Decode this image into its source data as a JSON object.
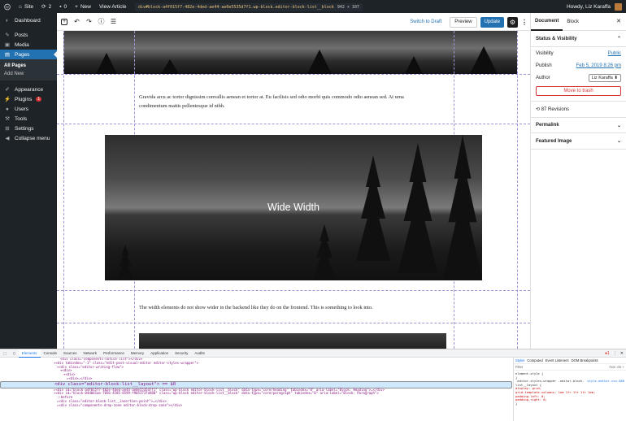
{
  "adminbar": {
    "site": "Site",
    "updates": "2",
    "comments": "0",
    "new": "New",
    "view": "View Article",
    "howdy": "Howdy, Liz Karaffa"
  },
  "tooltip": {
    "selector": "div#block-a4f015f7-482e-4ded-ae44-ae0e5535d7f1.wp-block.editor-block-list__block",
    "dims": "942 × 107"
  },
  "sidebar": {
    "items": [
      {
        "label": "Dashboard",
        "icon": "dashboard-icon"
      },
      {
        "label": "Posts",
        "icon": "pin-icon"
      },
      {
        "label": "Media",
        "icon": "media-icon"
      },
      {
        "label": "Pages",
        "icon": "page-icon"
      },
      {
        "label": "Appearance",
        "icon": "brush-icon"
      },
      {
        "label": "Plugins",
        "icon": "plugin-icon",
        "badge": "1"
      },
      {
        "label": "Users",
        "icon": "user-icon"
      },
      {
        "label": "Tools",
        "icon": "wrench-icon"
      },
      {
        "label": "Settings",
        "icon": "settings-icon"
      },
      {
        "label": "Collapse menu",
        "icon": "collapse-icon"
      }
    ],
    "sub": [
      "All Pages",
      "Add New"
    ]
  },
  "toolbar": {
    "switch_draft": "Switch to Draft",
    "preview": "Preview",
    "update": "Update"
  },
  "content": {
    "para1": "Gravida arcu ac tortor dignissim convallis aenean et tortor at. Eu facilisis sed odio morbi quis commodo odio aenean sed. At urna condimentum mattis pellentesque id nibh.",
    "wide_title": "Wide Width",
    "para2": "The width elements do not show wider in the backend like they do on the frontend. This is something to look into."
  },
  "settings": {
    "tab_document": "Document",
    "tab_block": "Block",
    "status_title": "Status & Visibility",
    "visibility_label": "Visibility",
    "visibility_value": "Public",
    "publish_label": "Publish",
    "publish_value": "Feb 5, 2019 8:26 pm",
    "author_label": "Author",
    "author_value": "Liz Karaffa",
    "trash": "Move to trash",
    "revisions": "87 Revisions",
    "permalink": "Permalink",
    "featured": "Featured Image"
  },
  "devtools": {
    "tabs": [
      "Elements",
      "Console",
      "Sources",
      "Network",
      "Performance",
      "Memory",
      "Application",
      "Security",
      "Audits"
    ],
    "error_count": "1",
    "dom_lines": [
      "<div class=\"components-notice-list\"></div>",
      "▾<div tabindex=\"-1\" class=\"edit-post-visual-editor editor-styles-wrapper\">",
      "  ▾<div class=\"editor-writing-flow\">",
      "    ▾<div>",
      "      ▾<div>",
      "        ▸<div>…</div>",
      "<div class=\"editor-block-list__layout\"> == $0",
      "  ▸<div id=\"block-a4f015f7-482e-4ded-ae44-ae0e5535d7f1\" class=\"wp-block editor-block-list__block\" data-type=\"core/heading\" tabindex=\"0\" aria-label=\"Block: Heading\">…</div>",
      "  ▾<div id=\"block-04d0d1ae-7056-4585-8599-f9053737d480\" class=\"wp-block editor-block-list__block\" data-type=\"core/paragraph\" tabindex=\"0\" aria-label=\"Block: Paragraph\">",
      "    ::before",
      "    ▸<div class=\"editor-block-list__insertion-point\">…</div>",
      "    ▸<div class=\"components-drop-zone editor-block-drop-zone\"></div>"
    ],
    "styles_tabs": [
      "Styles",
      "Computed",
      "Event Listeners",
      "DOM Breakpoints"
    ],
    "filter": "Filter",
    "filter_right": ":hov .cls +",
    "css_lines": [
      "element.style {",
      "}",
      ".editor-styles-wrapper .editor-block-",
      "list__layout {",
      "  display: grid;",
      "  grid-template-columns: 1em 1fr 1fr 1fr 1em;",
      "  padding-left: 0;",
      "  padding-right: 0;",
      "}"
    ],
    "css_link": "style-editor.css:386"
  }
}
